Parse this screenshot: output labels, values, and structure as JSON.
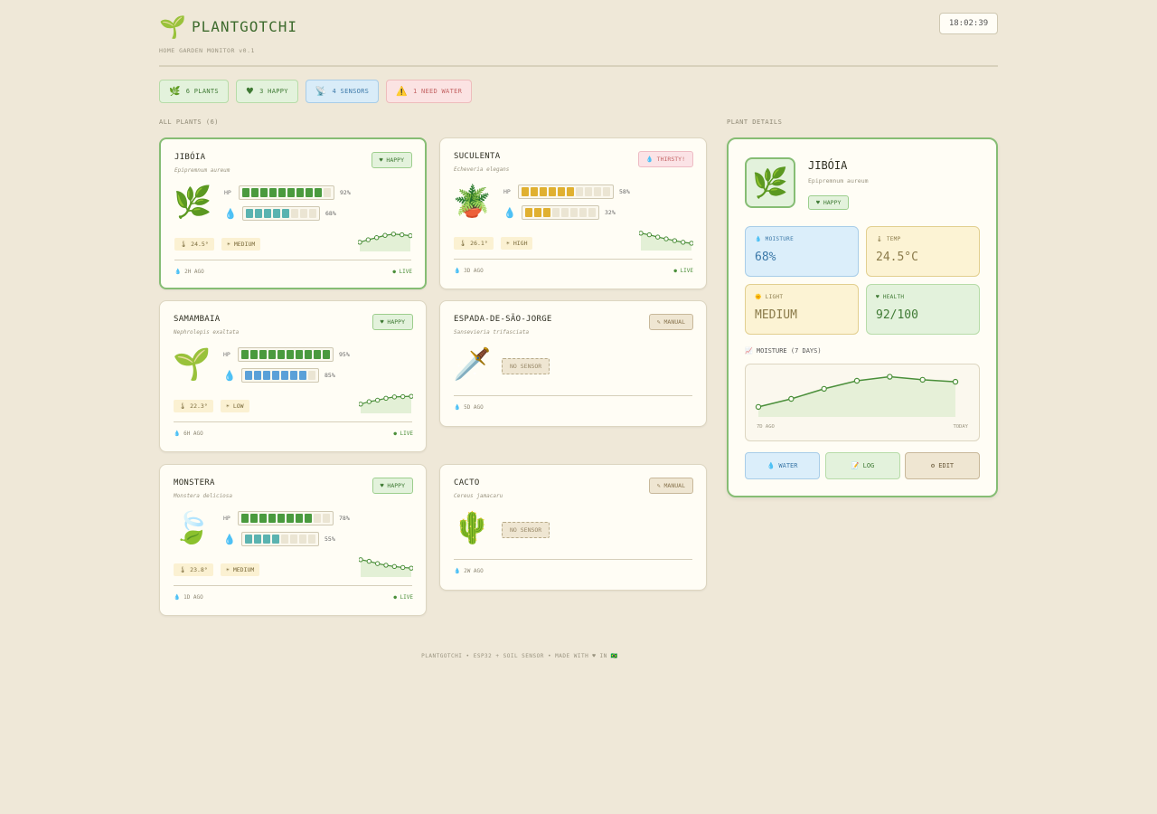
{
  "header": {
    "logo_icon": "🌱",
    "title": "PLANTGOTCHI",
    "subtitle": "HOME GARDEN MONITOR v0.1",
    "clock": "18:02:39"
  },
  "stats": [
    {
      "icon": "🌿",
      "label": "6 PLANTS",
      "style": "green"
    },
    {
      "icon": "♥",
      "label": "3 HAPPY",
      "style": "green"
    },
    {
      "icon": "📡",
      "label": "4 SENSORS",
      "style": "blue"
    },
    {
      "icon": "⚠️",
      "label": "1 NEED WATER",
      "style": "red"
    }
  ],
  "labels": {
    "all_plants": "ALL PLANTS (6)",
    "details": "PLANT DETAILS",
    "hp": "HP",
    "drop": "💧"
  },
  "plants": [
    {
      "name": "JIBÓIA",
      "sci": "Epipremnum aureum",
      "emoji": "🌿",
      "badge": "♥ HAPPY",
      "badge_type": "happy",
      "sensor": true,
      "hp": 92,
      "hp_segments": 9,
      "hp_color": "#4a9a3e",
      "water": 68,
      "water_segments": 5,
      "water_color": "#5ab3b0",
      "temp": "🌡 24.5°",
      "light": "☀ MEDIUM",
      "last": "💧 2H AGO",
      "live": "● LIVE",
      "trend": [
        40,
        55,
        68,
        82,
        90,
        86,
        80
      ]
    },
    {
      "name": "SUCULENTA",
      "sci": "Echeveria elegans",
      "emoji": "🪴",
      "badge": "💧 THIRSTY!",
      "badge_type": "thirsty",
      "sensor": true,
      "hp": 58,
      "hp_segments": 6,
      "hp_color": "#e0b030",
      "water": 32,
      "water_segments": 3,
      "water_color": "#e0b030",
      "temp": "🌡 26.1°",
      "light": "☀ HIGH",
      "last": "💧 3D AGO",
      "live": "● LIVE",
      "trend": [
        90,
        80,
        66,
        55,
        44,
        34,
        28
      ]
    },
    {
      "name": "SAMAMBAIA",
      "sci": "Nephrolepis exaltata",
      "emoji": "🌱",
      "badge": "♥ HAPPY",
      "badge_type": "happy",
      "sensor": true,
      "hp": 95,
      "hp_segments": 10,
      "hp_color": "#4a9a3e",
      "water": 85,
      "water_segments": 7,
      "water_color": "#5aa0d8",
      "temp": "🌡 22.3°",
      "light": "☀ LOW",
      "last": "💧 6H AGO",
      "live": "● LIVE",
      "trend": [
        40,
        55,
        64,
        76,
        84,
        86,
        88
      ]
    },
    {
      "name": "ESPADA-DE-SÃO-JORGE",
      "sci": "Sansevieria trifasciata",
      "emoji": "🗡️",
      "badge": "✎ MANUAL",
      "badge_type": "manual",
      "sensor": false,
      "no_sensor": "NO SENSOR",
      "last": "💧 5D AGO"
    },
    {
      "name": "MONSTERA",
      "sci": "Monstera deliciosa",
      "emoji": "🍃",
      "badge": "♥ HAPPY",
      "badge_type": "happy",
      "sensor": true,
      "hp": 78,
      "hp_segments": 8,
      "hp_color": "#4a9a3e",
      "water": 55,
      "water_segments": 4,
      "water_color": "#5ab3b0",
      "temp": "🌡 23.8°",
      "light": "☀ MEDIUM",
      "last": "💧 1D AGO",
      "live": "● LIVE",
      "trend": [
        90,
        80,
        66,
        56,
        48,
        42,
        38
      ]
    },
    {
      "name": "CACTO",
      "sci": "Cereus jamacaru",
      "emoji": "🌵",
      "badge": "✎ MANUAL",
      "badge_type": "manual",
      "sensor": false,
      "no_sensor": "NO SENSOR",
      "last": "💧 2W AGO"
    }
  ],
  "detail": {
    "emoji": "🌿",
    "name": "JIBÓIA",
    "sci": "Epipremnum aureum",
    "badge": "♥ HAPPY",
    "tiles": {
      "moisture_label": "💧 MOISTURE",
      "moisture_value": "68%",
      "temp_label": "🌡 TEMP",
      "temp_value": "24.5°C",
      "light_label": "🌞 LIGHT",
      "light_value": "MEDIUM",
      "health_label": "♥ HEALTH",
      "health_value": "92/100"
    },
    "chart_label": "📈 MOISTURE (7 DAYS)",
    "chart_start": "7D AGO",
    "chart_end": "TODAY",
    "buttons": {
      "water": "💧 WATER",
      "log": "📝 LOG",
      "edit": "⚙ EDIT"
    }
  },
  "chart_data": {
    "type": "line",
    "title": "MOISTURE (7 DAYS)",
    "x": [
      "7D AGO",
      "",
      "",
      "",
      "",
      "",
      "TODAY"
    ],
    "series": [
      {
        "values": [
          40,
          48,
          58,
          66,
          70,
          67,
          65
        ]
      }
    ],
    "ylim": [
      30,
      75
    ]
  },
  "footer": "PLANTGOTCHI • ESP32 + SOIL SENSOR • MADE WITH ♥ IN 🇧🇷"
}
